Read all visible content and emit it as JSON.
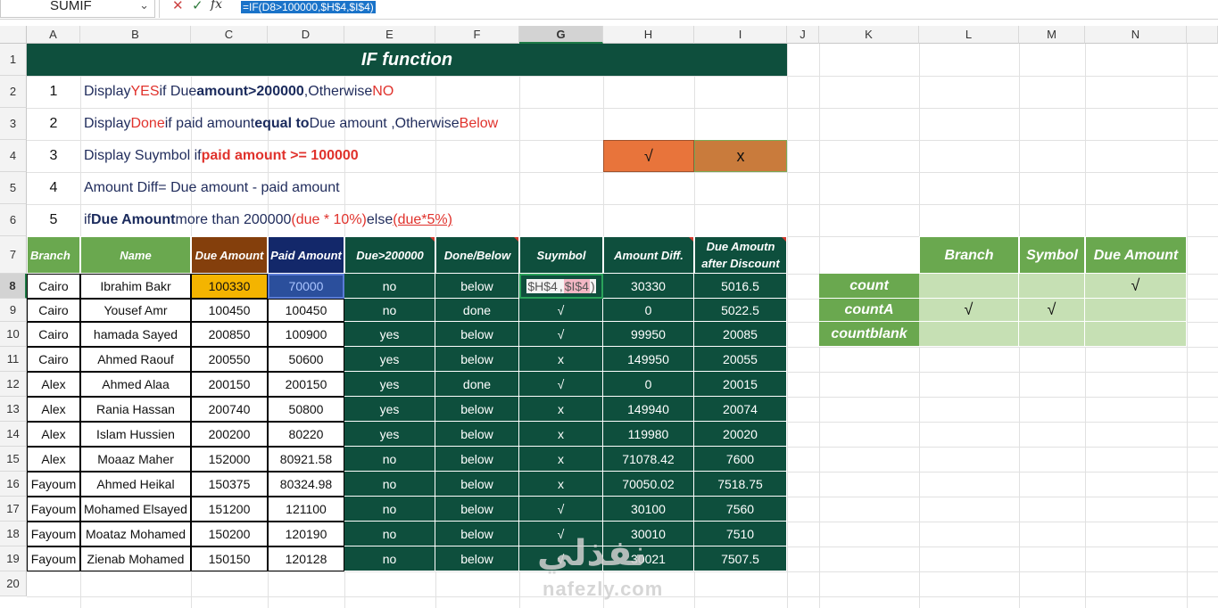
{
  "formula_bar": {
    "name_box": "SUMIF",
    "cancel_icon": "✕",
    "enter_icon": "✓",
    "fx_label": "fx",
    "formula": "=IF(D8>100000,$H$4,$I$4)"
  },
  "columns": [
    "A",
    "B",
    "C",
    "D",
    "E",
    "F",
    "G",
    "H",
    "I",
    "J",
    "K",
    "L",
    "M",
    "N"
  ],
  "rows": [
    "1",
    "2",
    "3",
    "4",
    "5",
    "6",
    "7",
    "8",
    "9",
    "10",
    "11",
    "12",
    "13",
    "14",
    "15",
    "16",
    "17",
    "18",
    "19",
    "20"
  ],
  "title": "IF function",
  "instructions": [
    {
      "num": "1",
      "p1": "Display ",
      "p2": "YES",
      "p3": " if Due ",
      "p4": "amount>200000",
      "p5": ",Otherwise ",
      "p6": "NO"
    },
    {
      "num": "2",
      "p1": "Display ",
      "p2": "Done",
      "p3": " if paid amount ",
      "p4": "equal to",
      "p5": " Due amount ,Otherwise ",
      "p6": "Below"
    },
    {
      "num": "3",
      "p1": "Display Suymbol if ",
      "p2": "paid amount >= 100000"
    },
    {
      "num": "4",
      "p1": "Amount Diff= Due amount - paid amount"
    },
    {
      "num": "5",
      "p1": "if ",
      "p2": "Due Amount",
      "p3": " more than 200000 ",
      "p4": "(due * 10%)",
      "p5": " else ",
      "p6": "(due*5%)"
    }
  ],
  "symbols": {
    "yes": "√",
    "no": "x"
  },
  "headers": {
    "branch": "Branch",
    "name": "Name",
    "due": "Due Amount",
    "paid": "Paid Amount",
    "due200": "Due>200000",
    "done": "Done/Below",
    "symbol": "Suymbol",
    "diff": "Amount Diff.",
    "disc": "Due Amoutn after Discount"
  },
  "table": [
    [
      "Cairo",
      "Ibrahim Bakr",
      "100330",
      "70000",
      "no",
      "below",
      "",
      "30330",
      "5016.5"
    ],
    [
      "Cairo",
      "Yousef Amr",
      "100450",
      "100450",
      "no",
      "done",
      "√",
      "0",
      "5022.5"
    ],
    [
      "Cairo",
      "hamada Sayed",
      "200850",
      "100900",
      "yes",
      "below",
      "√",
      "99950",
      "20085"
    ],
    [
      "Cairo",
      "Ahmed Raouf",
      "200550",
      "50600",
      "yes",
      "below",
      "x",
      "149950",
      "20055"
    ],
    [
      "Alex",
      "Ahmed Alaa",
      "200150",
      "200150",
      "yes",
      "done",
      "√",
      "0",
      "20015"
    ],
    [
      "Alex",
      "Rania Hassan",
      "200740",
      "50800",
      "yes",
      "below",
      "x",
      "149940",
      "20074"
    ],
    [
      "Alex",
      "Islam Hussien",
      "200200",
      "80220",
      "yes",
      "below",
      "x",
      "119980",
      "20020"
    ],
    [
      "Alex",
      "Moaaz Maher",
      "152000",
      "80921.58",
      "no",
      "below",
      "x",
      "71078.42",
      "7600"
    ],
    [
      "Fayoum",
      "Ahmed Heikal",
      "150375",
      "80324.98",
      "no",
      "below",
      "x",
      "70050.02",
      "7518.75"
    ],
    [
      "Fayoum",
      "Mohamed Elsayed",
      "151200",
      "121100",
      "no",
      "below",
      "√",
      "30100",
      "7560"
    ],
    [
      "Fayoum",
      "Moataz Mohamed",
      "150200",
      "120190",
      "no",
      "below",
      "√",
      "30010",
      "7510"
    ],
    [
      "Fayoum",
      "Zienab Mohamed",
      "150150",
      "120128",
      "no",
      "below",
      "√",
      "30021",
      "7507.5"
    ]
  ],
  "edit_cell": {
    "part1": "$H$4",
    "sep": " , ",
    "part2": "$I$4",
    "close": " )"
  },
  "count_table": {
    "headers": [
      "Branch",
      "Symbol",
      "Due Amount"
    ],
    "rows": [
      {
        "label": "count",
        "vals": [
          "",
          "",
          "√"
        ]
      },
      {
        "label": "countA",
        "vals": [
          "√",
          "√",
          ""
        ]
      },
      {
        "label": "countblank",
        "vals": [
          "",
          "",
          ""
        ]
      }
    ]
  },
  "watermark": {
    "arabic": "نفذلي",
    "latin": "nafezly.com"
  }
}
